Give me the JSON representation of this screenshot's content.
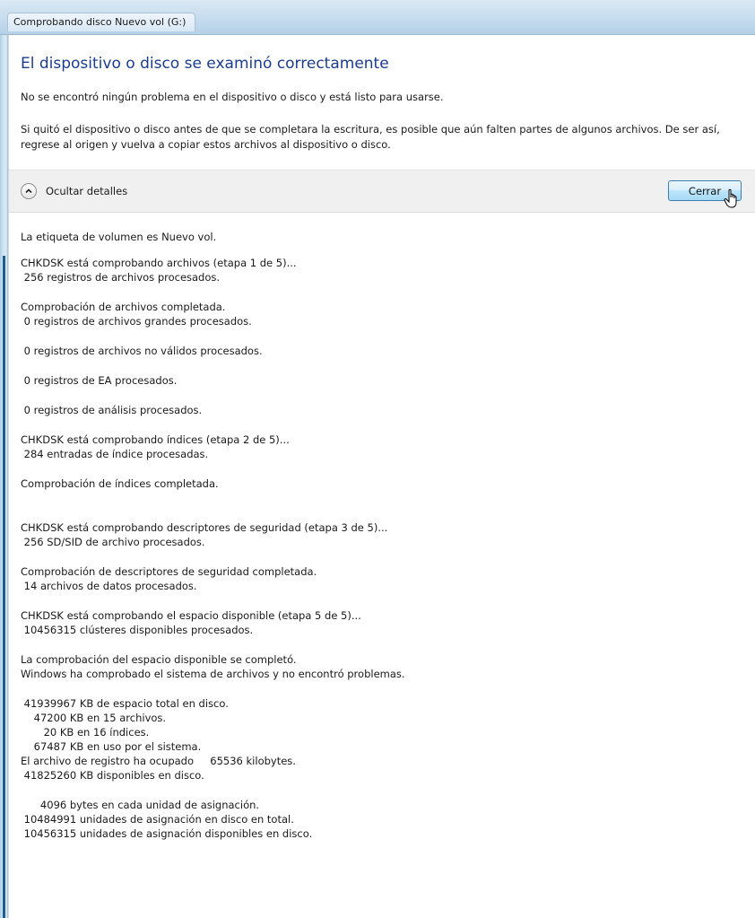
{
  "window": {
    "title": "Comprobando disco  Nuevo vol (G:)"
  },
  "header": {
    "heading": "El dispositivo o disco se examinó correctamente",
    "message1": "No se encontró ningún problema en el dispositivo o disco y está listo para usarse.",
    "message2": "Si quitó el dispositivo o disco antes de que se completara la escritura, es posible que aún falten partes de algunos archivos. De ser así, regrese al origen y vuelva a copiar estos archivos al dispositivo o disco."
  },
  "controls": {
    "toggle_label": "Ocultar detalles",
    "toggle_icon": "chevron-up-icon",
    "close_label": "Cerrar"
  },
  "details": {
    "blocks": [
      {
        "lines": [
          "La etiqueta de volumen es Nuevo vol."
        ]
      },
      {
        "lines": [
          "CHKDSK está comprobando archivos (etapa 1 de 5)...",
          " 256 registros de archivos procesados."
        ]
      },
      {
        "lines": [
          "Comprobación de archivos completada.",
          " 0 registros de archivos grandes procesados."
        ]
      },
      {
        "lines": [
          " 0 registros de archivos no válidos procesados."
        ]
      },
      {
        "lines": [
          " 0 registros de EA procesados."
        ]
      },
      {
        "lines": [
          " 0 registros de análisis procesados."
        ]
      },
      {
        "lines": [
          "CHKDSK está comprobando índices (etapa 2 de 5)...",
          " 284 entradas de índice procesadas."
        ]
      },
      {
        "lines": [
          "Comprobación de índices completada."
        ]
      },
      {
        "lines": [
          "CHKDSK está comprobando descriptores de seguridad (etapa 3 de 5)...",
          " 256 SD/SID de archivo procesados."
        ]
      },
      {
        "lines": [
          "Comprobación de descriptores de seguridad completada.",
          " 14 archivos de datos procesados."
        ]
      },
      {
        "lines": [
          "CHKDSK está comprobando el espacio disponible (etapa 5 de 5)...",
          " 10456315 clústeres disponibles procesados."
        ]
      },
      {
        "lines": [
          "La comprobación del espacio disponible se completó.",
          "Windows ha comprobado el sistema de archivos y no encontró problemas."
        ]
      },
      {
        "lines": [
          " 41939967 KB de espacio total en disco.",
          "    47200 KB en 15 archivos.",
          "       20 KB en 16 índices.",
          "    67487 KB en uso por el sistema.",
          "El archivo de registro ha ocupado     65536 kilobytes.",
          " 41825260 KB disponibles en disco."
        ]
      },
      {
        "lines": [
          "      4096 bytes en cada unidad de asignación.",
          " 10484991 unidades de asignación en disco en total.",
          " 10456315 unidades de asignación disponibles en disco."
        ]
      }
    ]
  }
}
